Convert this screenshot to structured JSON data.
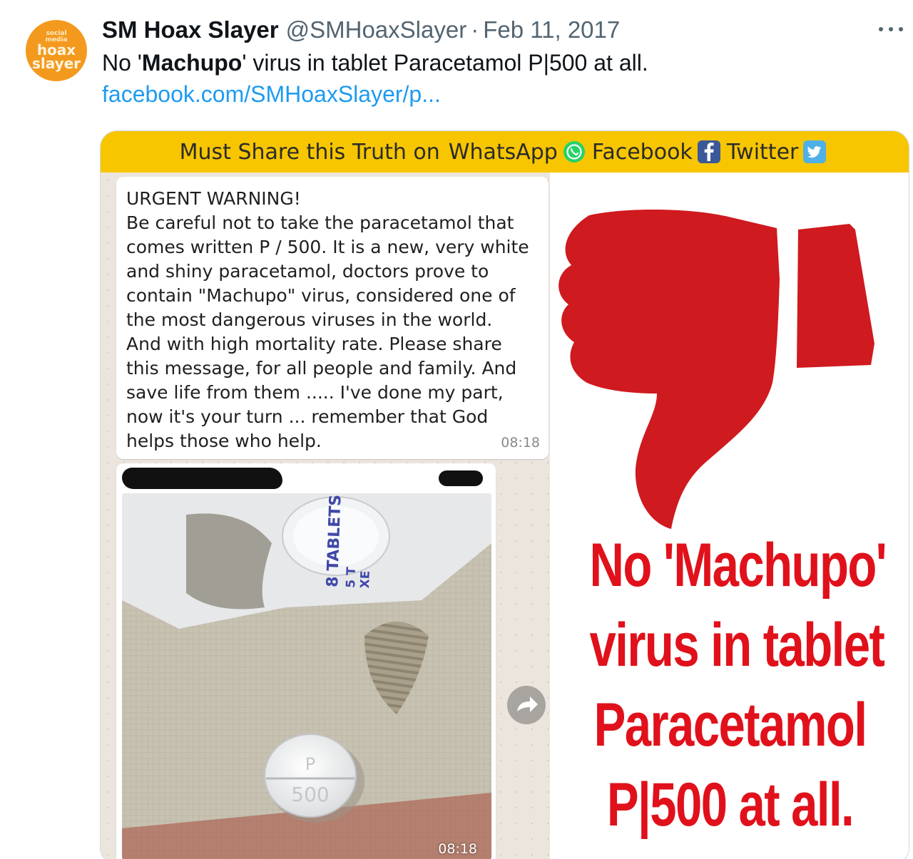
{
  "tweet": {
    "avatar_text": {
      "line1": "social",
      "line2": "media",
      "line3": "hoax",
      "line4": "slayer"
    },
    "display_name": "SM Hoax Slayer",
    "handle": "@SMHoaxSlayer",
    "separator": "·",
    "date": "Feb 11, 2017",
    "text_prefix": "No '",
    "text_bold": "Machupo",
    "text_suffix": "' virus in tablet Paracetamol P|500 at all.",
    "link": "facebook.com/SMHoaxSlayer/p...",
    "more_icon": "more-icon"
  },
  "media": {
    "banner": {
      "prefix": "Must Share this Truth on",
      "whatsapp": "WhatsApp",
      "facebook": "Facebook",
      "twitter": "Twitter",
      "background": "#f7c600"
    },
    "chat": {
      "message_lines": [
        "URGENT WARNING!",
        "Be careful not to take the paracetamol that",
        "comes written P / 500. It is a new, very white",
        "and shiny paracetamol, doctors prove to",
        "contain \"Machupo\" virus, considered one of",
        "the most dangerous viruses in the world.",
        "And with high mortality rate. Please share",
        "this message, for all people and family. And",
        "save life from them ..... I've done my part,",
        "now it's your turn ... remember that God",
        "helps those who help."
      ],
      "message_time": "08:18",
      "photo_time": "08:18",
      "photo_blister_text": "8 TABLETS",
      "photo_blister_text2": "5 T",
      "photo_blister_text3": "XE",
      "pill_text_top": "P",
      "pill_text_bottom": "500"
    },
    "claim_lines": [
      "No 'Machupo'",
      "virus in tablet",
      "Paracetamol",
      "P|500 at all."
    ],
    "claim_color": "#e0111b",
    "thumb_color": "#cf1a1f"
  },
  "colors": {
    "link": "#1d9bf0",
    "secondary_text": "#536471",
    "avatar": "#f39a1e"
  }
}
